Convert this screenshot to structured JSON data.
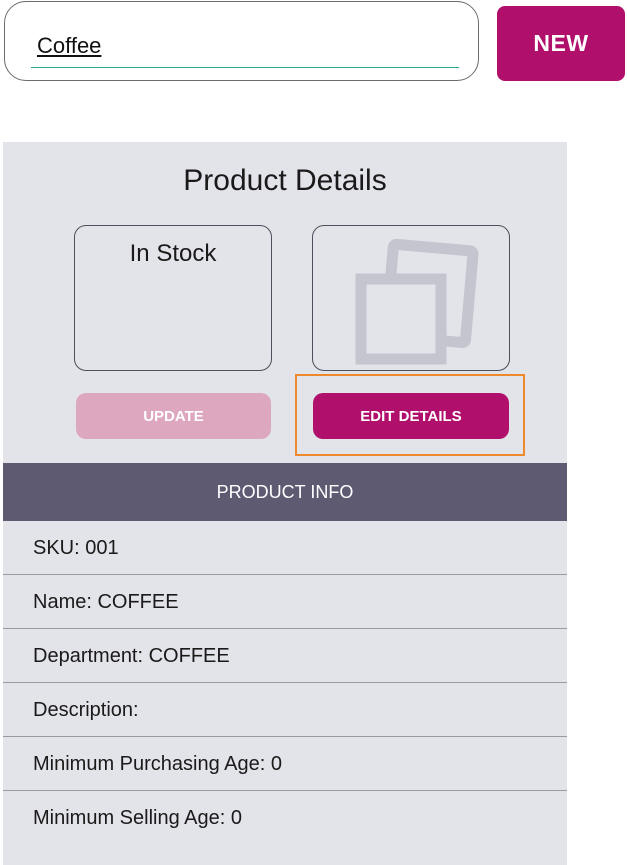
{
  "search": {
    "value": "Coffee"
  },
  "toolbar": {
    "new_label": "NEW"
  },
  "panel": {
    "title": "Product Details",
    "stock_status": "In Stock",
    "image_icon": "image-gallery-icon",
    "update_label": "UPDATE",
    "edit_label": "EDIT DETAILS",
    "info_header": "PRODUCT INFO"
  },
  "product_info": [
    "SKU: 001",
    "Name: COFFEE",
    "Department: COFFEE",
    "Description:",
    "Minimum Purchasing Age: 0",
    "Minimum Selling Age: 0"
  ],
  "colors": {
    "accent": "#b0106b",
    "accent_disabled": "#dda7bf",
    "panel_background": "#e3e3ea",
    "header_background": "#5d5a72",
    "highlight": "#ef8a2c",
    "input_underline": "#2ea88c"
  }
}
